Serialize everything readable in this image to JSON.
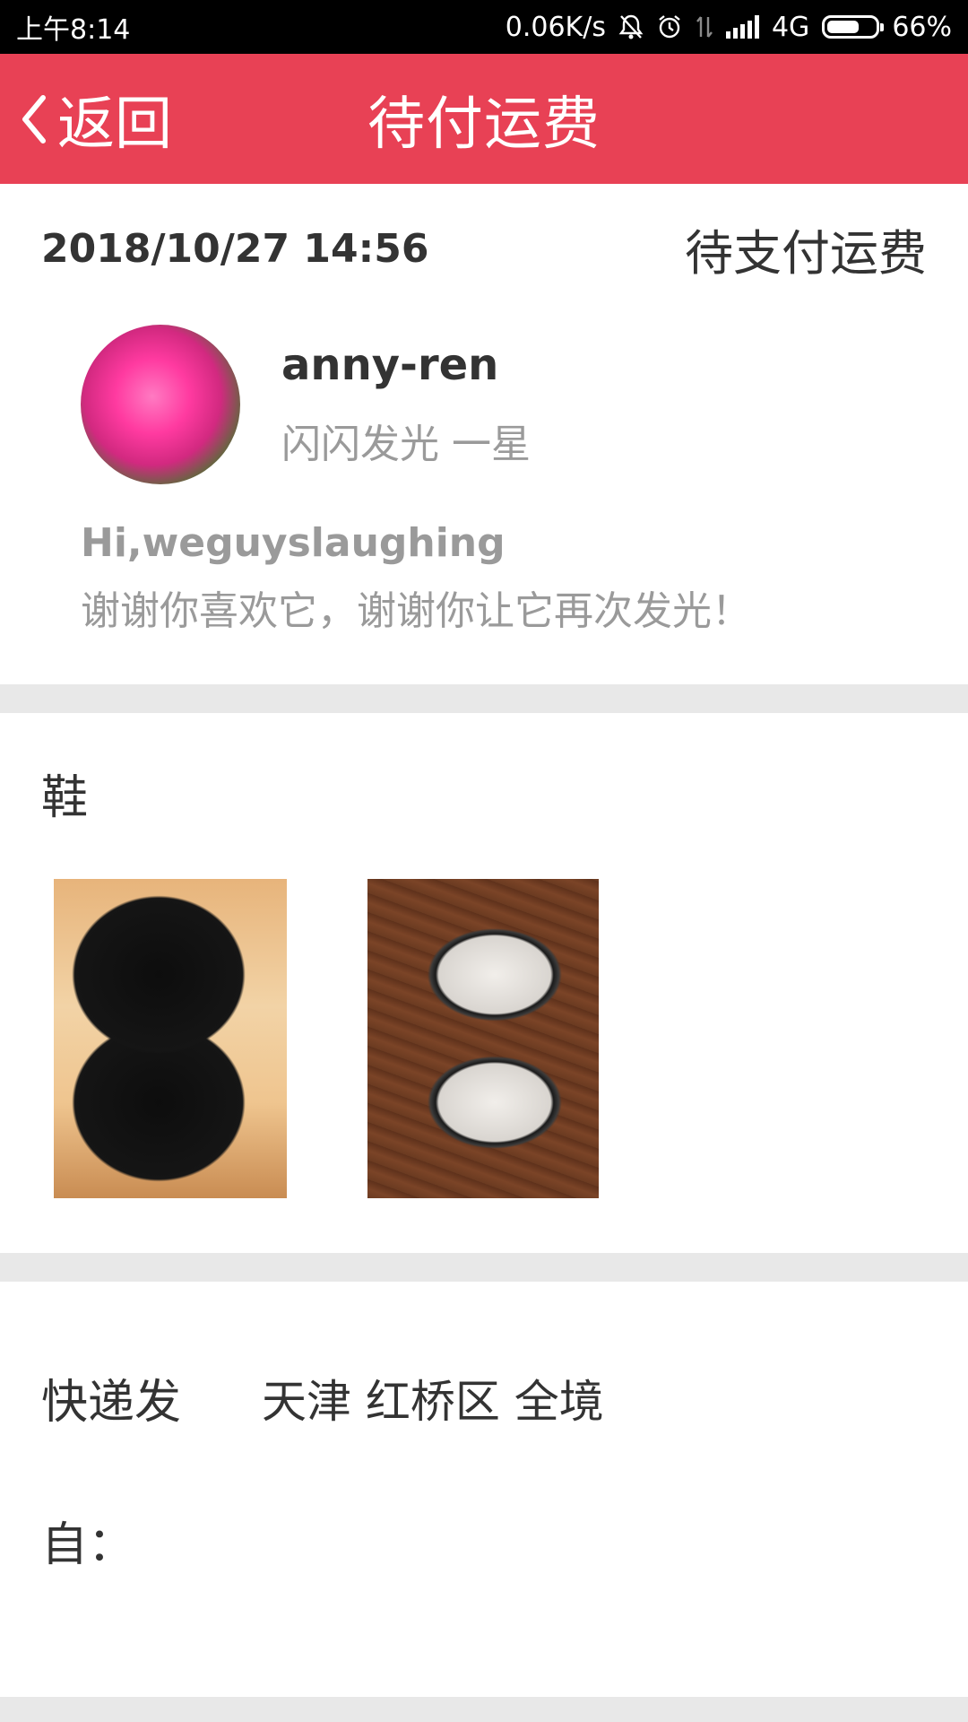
{
  "status_bar": {
    "time": "上午8:14",
    "net_speed": "0.06K/s",
    "network": "4G",
    "battery": "66%",
    "battery_level": 0.66,
    "icons": [
      "mute-bell-icon",
      "alarm-icon",
      "data-arrows-icon",
      "signal-icon",
      "battery-icon"
    ]
  },
  "header": {
    "back_label": "返回",
    "title": "待付运费",
    "background_color": "#e84155"
  },
  "order": {
    "datetime": "2018/10/27  14:56",
    "status": "待支付运费"
  },
  "seller": {
    "name": "anny-ren",
    "rank": "闪闪发光 一星"
  },
  "greeting": {
    "to": "Hi,weguyslaughing",
    "message": "谢谢你喜欢它，谢谢你让它再次发光！"
  },
  "items": {
    "category": "鞋",
    "photos": [
      "black-furry-shoes-photo",
      "black-white-flats-photo"
    ]
  },
  "shipping": {
    "method_label": "快递发",
    "address": "天津 红桥区 全境",
    "from_label": "自："
  }
}
